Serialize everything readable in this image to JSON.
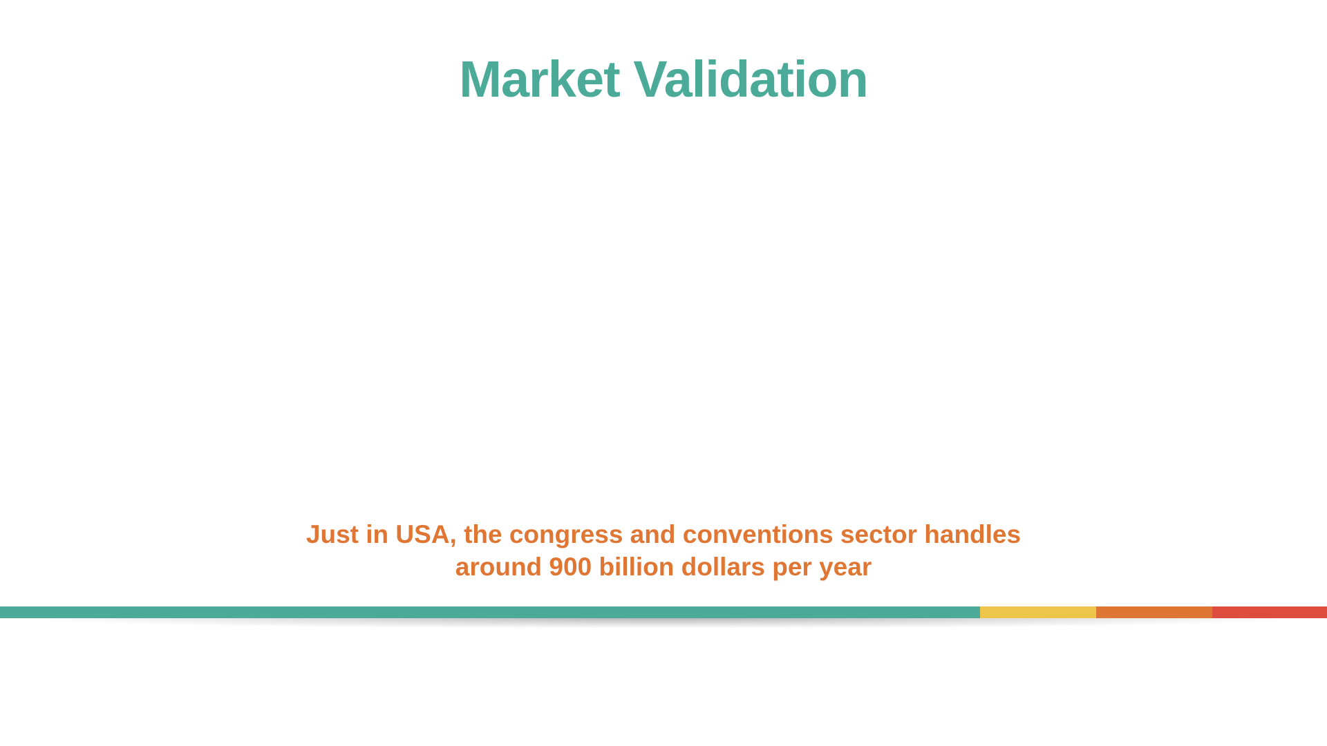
{
  "slide": {
    "title": "Market Validation",
    "caption_lines": [
      "Just in USA, the congress and conventions sector handles",
      "around 900 billion dollars per year"
    ]
  },
  "colors": {
    "title": "#4bab98",
    "caption": "#e07633",
    "stripe_teal": "#4bab98",
    "stripe_yellow": "#ecc54a",
    "stripe_orange": "#e07633",
    "stripe_red": "#dc4c3f"
  }
}
